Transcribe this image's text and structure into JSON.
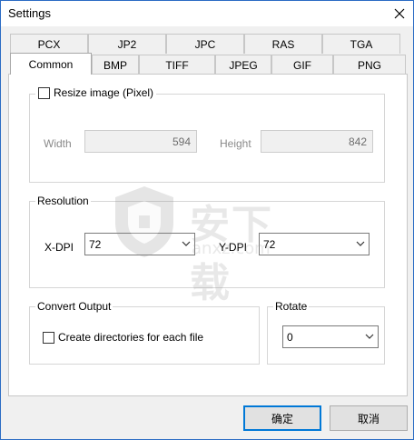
{
  "window": {
    "title": "Settings"
  },
  "tabs": {
    "row1": [
      "PCX",
      "JP2",
      "JPC",
      "RAS",
      "TGA"
    ],
    "row2": [
      "Common",
      "BMP",
      "TIFF",
      "JPEG",
      "GIF",
      "PNG"
    ],
    "active": "Common"
  },
  "resize": {
    "checkbox_label": "Resize image (Pixel)",
    "checked": false,
    "width_label": "Width",
    "width_value": "594",
    "height_label": "Height",
    "height_value": "842"
  },
  "resolution": {
    "group_label": "Resolution",
    "xdpi_label": "X-DPI",
    "xdpi_value": "72",
    "ydpi_label": "Y-DPI",
    "ydpi_value": "72"
  },
  "convert_output": {
    "group_label": "Convert Output",
    "checkbox_label": "Create directories for each file",
    "checked": false
  },
  "rotate": {
    "group_label": "Rotate",
    "value": "0"
  },
  "watermark": {
    "text": "安下载",
    "sub": "anxz.com"
  },
  "buttons": {
    "ok": "确定",
    "cancel": "取消"
  },
  "colors": {
    "focus_border": "#0078d7",
    "window_border": "#2b6cc4"
  }
}
